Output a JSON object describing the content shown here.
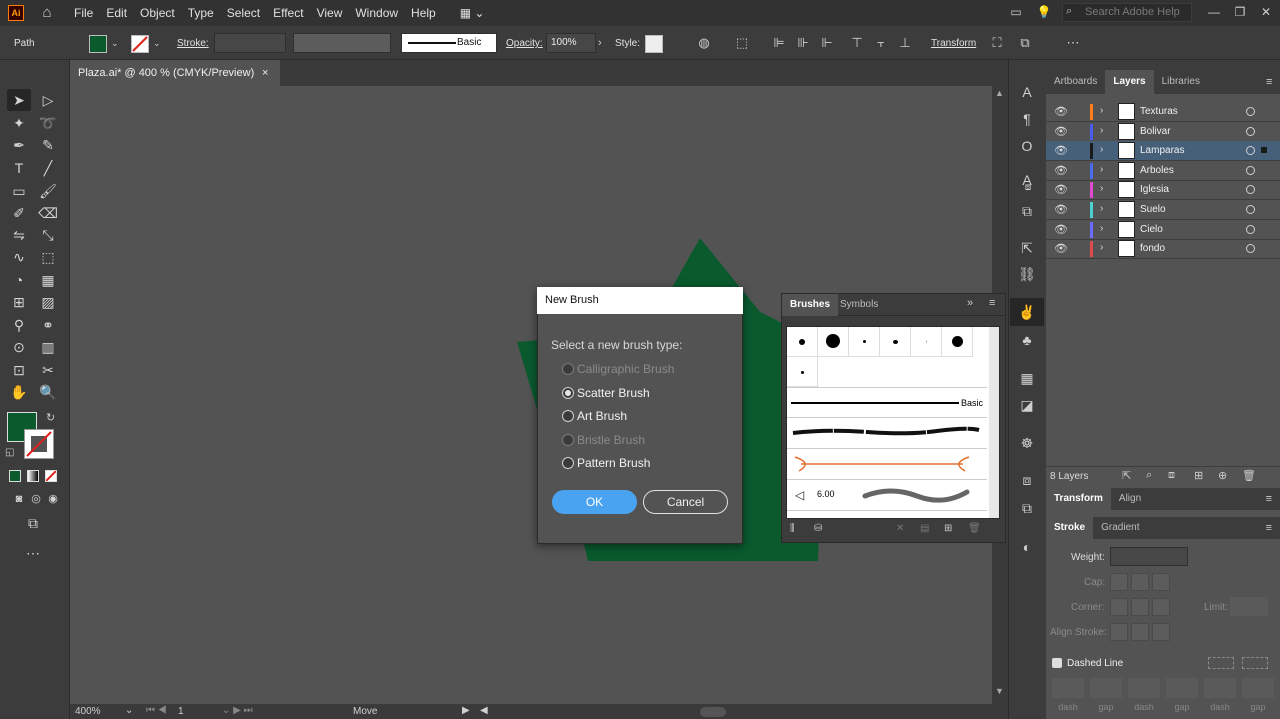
{
  "app": {
    "logo": "Ai"
  },
  "menu": [
    "File",
    "Edit",
    "Object",
    "Type",
    "Select",
    "Effect",
    "View",
    "Window",
    "Help"
  ],
  "search": {
    "placeholder": "Search Adobe Help"
  },
  "control_bar": {
    "selection": "Path",
    "stroke_label": "Stroke:",
    "stroke_profile": "Basic",
    "opacity_label": "Opacity:",
    "opacity_value": "100%",
    "style_label": "Style:",
    "transform_label": "Transform",
    "fill_color": "#0a5a2e"
  },
  "document": {
    "tab_title": "Plaza.ai* @ 400 % (CMYK/Preview)",
    "close": "×"
  },
  "status_bar": {
    "zoom": "400%",
    "artboard": "1",
    "tool": "Move"
  },
  "right_tabs": {
    "artboards": "Artboards",
    "layers": "Layers",
    "libraries": "Libraries"
  },
  "layers": [
    {
      "name": "Texturas",
      "color": "#ff7c1a"
    },
    {
      "name": "Bolivar",
      "color": "#4a5cf0"
    },
    {
      "name": "Lamparas",
      "color": "#1a1a1a"
    },
    {
      "name": "Arboles",
      "color": "#4a6cf0"
    },
    {
      "name": "Iglesia",
      "color": "#e04ad0"
    },
    {
      "name": "Suelo",
      "color": "#4ad0d0"
    },
    {
      "name": "Cielo",
      "color": "#6a6aff"
    },
    {
      "name": "fondo",
      "color": "#e04a4a"
    }
  ],
  "layers_footer": {
    "count": "8 Layers"
  },
  "transform_panel": {
    "tab1": "Transform",
    "tab2": "Align"
  },
  "stroke_panel": {
    "tab1": "Stroke",
    "tab2": "Gradient",
    "weight_label": "Weight:",
    "cap_label": "Cap:",
    "corner_label": "Corner:",
    "limit_label": "Limit:",
    "align_label": "Align Stroke:",
    "dashed_label": "Dashed Line",
    "dash_labels": [
      "dash",
      "gap",
      "dash",
      "gap",
      "dash",
      "gap"
    ]
  },
  "brushes_panel": {
    "tab1": "Brushes",
    "tab2": "Symbols",
    "basic_label": "Basic",
    "size_label": "6.00"
  },
  "dialog": {
    "title": "New Brush",
    "prompt": "Select a new brush type:",
    "options": [
      {
        "label": "Calligraphic Brush",
        "disabled": true,
        "checked": false
      },
      {
        "label": "Scatter Brush",
        "disabled": false,
        "checked": true
      },
      {
        "label": "Art Brush",
        "disabled": false,
        "checked": false
      },
      {
        "label": "Bristle Brush",
        "disabled": true,
        "checked": false
      },
      {
        "label": "Pattern Brush",
        "disabled": false,
        "checked": false
      }
    ],
    "ok": "OK",
    "cancel": "Cancel"
  },
  "colors": {
    "accent": "#4aa3f0",
    "artwork_green": "#0a5a2e"
  }
}
